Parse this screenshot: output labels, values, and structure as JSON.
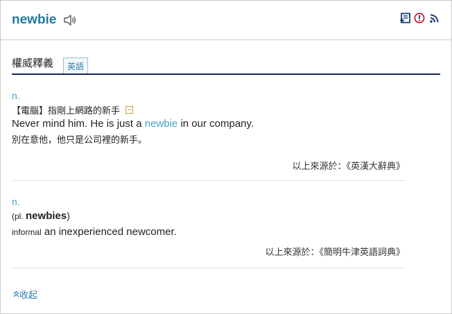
{
  "header": {
    "word": "newbie",
    "icons": [
      "speaker-icon",
      "add-to-wordbook-icon",
      "report-icon",
      "rss-icon"
    ]
  },
  "tabs": {
    "title": "權威釋義",
    "lang": "英語"
  },
  "entries": [
    {
      "pos": "n.",
      "definition": "【電腦】指剛上網路的新手",
      "example_prefix": "Never mind him. He is just a ",
      "example_highlight": "newbie",
      "example_suffix": " in our company.",
      "example_zh": "別在意他，他只是公司裡的新手。",
      "source": "以上來源於：《英漢大辭典》"
    },
    {
      "pos": "n.",
      "plural_open": "(pl. ",
      "plural_word": "newbies",
      "plural_close": ")",
      "label": "informal",
      "definition": " an inexperienced newcomer.",
      "source": "以上來源於：《簡明牛津英語詞典》"
    }
  ],
  "footer": {
    "collapse_label": "收起"
  },
  "colors": {
    "accent": "#1f7a9c",
    "link": "#4a9fc8",
    "tab_border": "#14285a",
    "report": "#d0021b"
  }
}
